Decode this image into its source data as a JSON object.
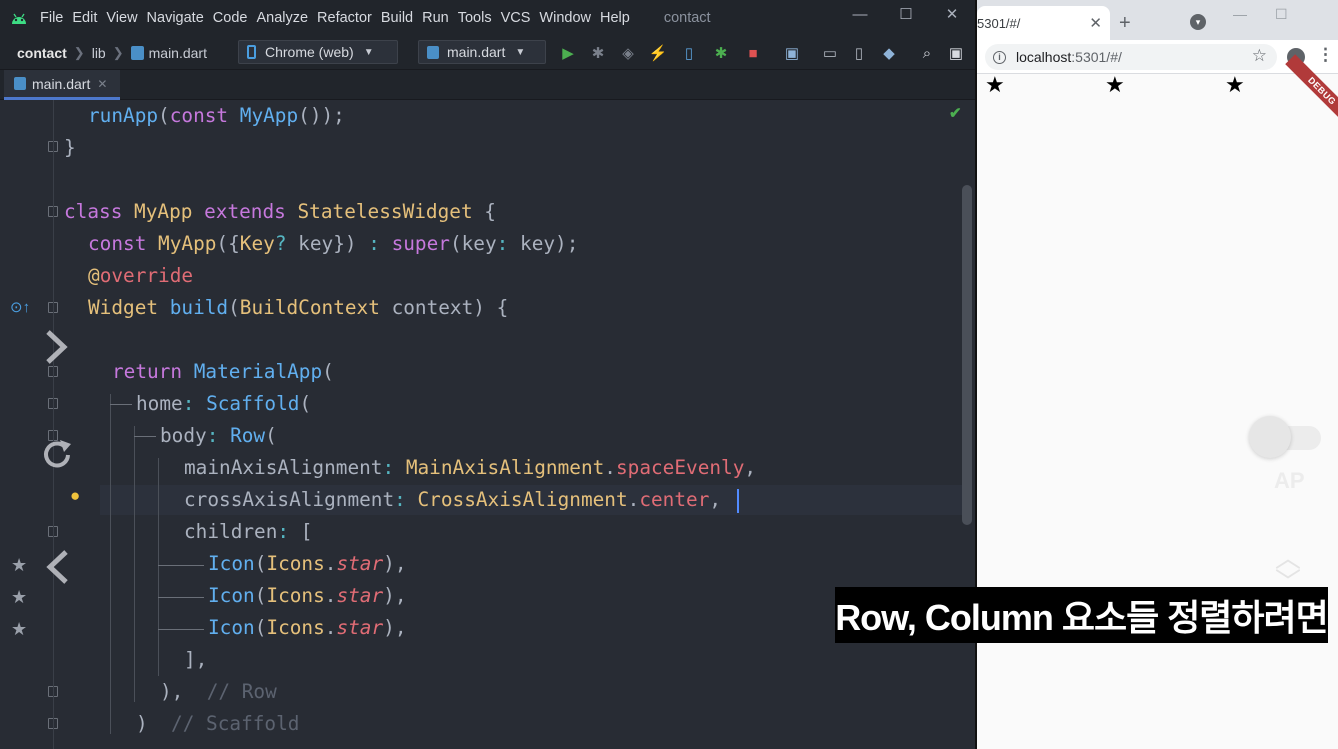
{
  "ide": {
    "menu": [
      "File",
      "Edit",
      "View",
      "Navigate",
      "Code",
      "Analyze",
      "Refactor",
      "Build",
      "Run",
      "Tools",
      "VCS",
      "Window",
      "Help"
    ],
    "project_title": "contact",
    "window_controls": [
      "—",
      "☐",
      "✕"
    ],
    "breadcrumbs": [
      "contact",
      "lib",
      "main.dart"
    ],
    "device_selector": "Chrome (web)",
    "run_config": "main.dart",
    "tab_label": "main.dart",
    "code": [
      "runApp(const MyApp());",
      "}",
      "",
      "class MyApp extends StatelessWidget {",
      "const MyApp({Key? key}) : super(key: key);",
      "@override",
      "Widget build(BuildContext context) {",
      "",
      "return MaterialApp(",
      "home: Scaffold(",
      "body: Row(",
      "mainAxisAlignment: MainAxisAlignment.spaceEvenly,",
      "crossAxisAlignment: CrossAxisAlignment.center,",
      "children: [",
      "Icon(Icons.star),",
      "Icon(Icons.star),",
      "Icon(Icons.star),",
      "],",
      "),  // Row",
      ")  // Scaffold"
    ]
  },
  "browser": {
    "tab_title": "5301/#/",
    "url_host": "localhost",
    "url_path": ":5301/#/",
    "debug_banner": "DEBUG",
    "overlay_label": "AP"
  },
  "caption": "Row, Column 요소들 정렬하려면",
  "colors": {
    "keyword": "#c678dd",
    "type": "#e5c07b",
    "function": "#61afef",
    "property": "#e06c75",
    "comment": "#5c6370",
    "accent": "#4d78cc"
  }
}
